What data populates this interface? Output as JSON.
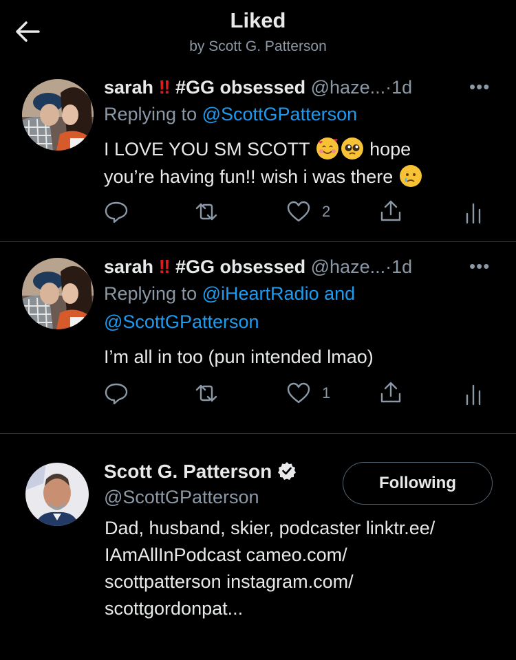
{
  "header": {
    "title": "Liked",
    "subtitle": "by Scott G. Patterson"
  },
  "tweets": [
    {
      "name": "sarah",
      "tag": "#GG obsessed",
      "handle": "@haze...",
      "separator": "·",
      "time": "1d",
      "replying_prefix": "Replying to",
      "replying_to": "@ScottGPatterson",
      "text_line1_a": "I LOVE YOU SM SCOTT",
      "text_line1_b": "hope",
      "text_line2": "you’re having fun!! wish i was there",
      "likes": "2",
      "emojis": [
        "smiling-face-with-hearts",
        "pleading-face",
        "sad-tear-face"
      ]
    },
    {
      "name": "sarah",
      "tag": "#GG obsessed",
      "handle": "@haze...",
      "separator": "·",
      "time": "1d",
      "replying_prefix": "Replying to",
      "replying_to_1": "@iHeartRadio and",
      "replying_to_2": "@ScottGPatterson",
      "text": "I’m all in too (pun intended lmao)",
      "likes": "1"
    }
  ],
  "profile": {
    "name": "Scott G. Patterson",
    "handle": "@ScottGPatterson",
    "follow_label": "Following",
    "bio_lines": [
      "Dad, husband, skier, podcaster linktr.ee/",
      "IAmAllInPodcast cameo.com/",
      "scottpatterson instagram.com/",
      "scottgordonpat..."
    ]
  },
  "colors": {
    "background": "#000000",
    "link": "#1d9bf0",
    "secondary_text": "#8b98a5",
    "divider": "#2f3336"
  }
}
